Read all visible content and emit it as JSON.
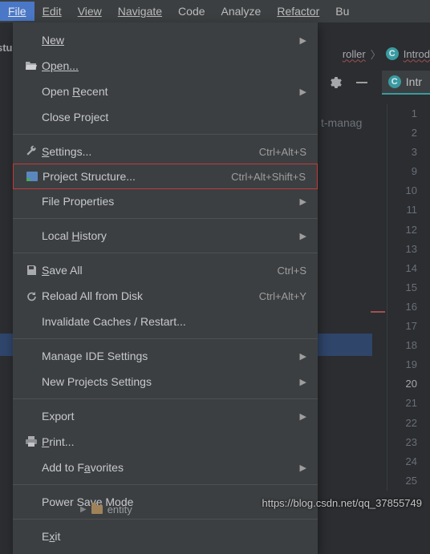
{
  "menubar": {
    "file": "File",
    "edit": "Edit",
    "view": "View",
    "navigate": "Navigate",
    "code": "Code",
    "analyze": "Analyze",
    "refactor": "Refactor",
    "build_fragment": "Bu"
  },
  "stub_text": "stu",
  "breadcrumb": {
    "item1": "roller",
    "badge": "C",
    "item2": "Introd"
  },
  "tab": {
    "badge": "C",
    "label": "Intr"
  },
  "bg_label": "t-manag",
  "gutter_lines": [
    "1",
    "2",
    "3",
    "9",
    "10",
    "11",
    "12",
    "13",
    "14",
    "15",
    "16",
    "17",
    "18",
    "19",
    "20",
    "21",
    "22",
    "23",
    "24",
    "25"
  ],
  "gutter_current_index": 14,
  "menu": {
    "new": "New",
    "open": "Open...",
    "open_recent": "Open Recent",
    "close_project": "Close Project",
    "settings": {
      "label": "Settings...",
      "shortcut": "Ctrl+Alt+S"
    },
    "project_structure": {
      "label": "Project Structure...",
      "shortcut": "Ctrl+Alt+Shift+S"
    },
    "file_properties": "File Properties",
    "local_history": "Local History",
    "save_all": {
      "label": "Save All",
      "shortcut": "Ctrl+S"
    },
    "reload": {
      "label": "Reload All from Disk",
      "shortcut": "Ctrl+Alt+Y"
    },
    "invalidate": "Invalidate Caches / Restart...",
    "manage_ide": "Manage IDE Settings",
    "new_projects_settings": "New Projects Settings",
    "export": "Export",
    "print": "Print...",
    "add_favorites": "Add to Favorites",
    "power_save": "Power Save Mode",
    "exit": "Exit"
  },
  "tree_item": "entity",
  "watermark": "https://blog.csdn.net/qq_37855749"
}
